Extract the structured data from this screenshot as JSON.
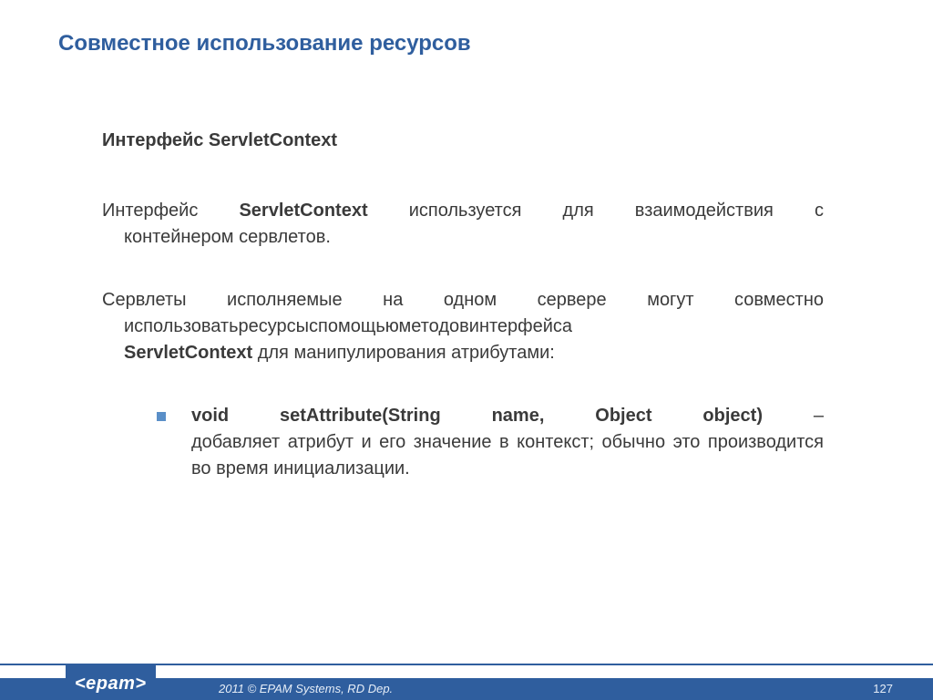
{
  "title": "Совместное использование ресурсов",
  "subheading": "Интерфейс ServletContext",
  "para1": {
    "line1_words": [
      "Интерфейс",
      "ServletContext",
      "используется",
      "для",
      "взаимодействия",
      "с"
    ],
    "line1_bold_index": 1,
    "line2": "контейнером сервлетов."
  },
  "para2": {
    "line1_words": [
      "Сервлеты",
      "исполняемые",
      "на",
      "одном",
      "сервере",
      "могут",
      "совместно"
    ],
    "line2_words": [
      "использовать",
      "ресурсы",
      "с",
      "помощью",
      "методов",
      "интерфейса"
    ],
    "line3_pre": "ServletContext",
    "line3_post": " для манипулирования атрибутами:"
  },
  "bullet": {
    "line1_words": [
      "void",
      "setAttribute(String",
      "name,",
      "Object",
      "object)",
      "–"
    ],
    "line1_bold_through": 4,
    "rest": "добавляет атрибут и его значение в контекст; обычно это производится во время инициализации."
  },
  "footer": {
    "logo": "<epam>",
    "copyright": "2011 © EPAM Systems, RD Dep.",
    "page": "127"
  }
}
